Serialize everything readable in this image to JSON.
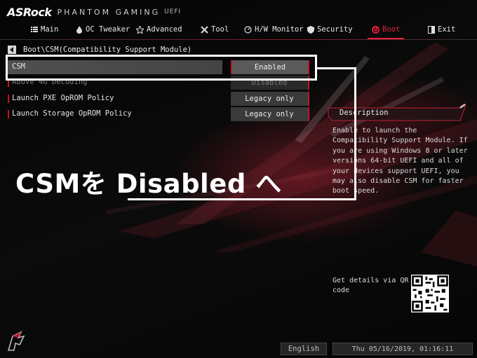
{
  "header": {
    "brand": "ASRock",
    "product": "PHANTOM GAMING",
    "uefi": "UEFI"
  },
  "nav": {
    "items": [
      {
        "label": "Main",
        "icon": "list-icon"
      },
      {
        "label": "OC Tweaker",
        "icon": "flame-icon"
      },
      {
        "label": "Advanced",
        "icon": "star-icon"
      },
      {
        "label": "Tool",
        "icon": "tools-icon"
      },
      {
        "label": "H/W Monitor",
        "icon": "monitor-icon"
      },
      {
        "label": "Security",
        "icon": "shield-icon"
      },
      {
        "label": "Boot",
        "icon": "power-icon"
      },
      {
        "label": "Exit",
        "icon": "exit-icon"
      }
    ],
    "active": "Boot"
  },
  "breadcrumb": "Boot\\CSM(Compatibility Support Module)",
  "options": [
    {
      "label": "CSM",
      "value": "Enabled",
      "selected": true,
      "disabled": false
    },
    {
      "label": "Above 4G Decoding",
      "value": "Disabled",
      "selected": false,
      "disabled": true
    },
    {
      "label": "Launch PXE OpROM Policy",
      "value": "Legacy only",
      "selected": false,
      "disabled": false
    },
    {
      "label": "Launch Storage OpROM Policy",
      "value": "Legacy only",
      "selected": false,
      "disabled": false
    }
  ],
  "description": {
    "title": "Description",
    "text": "Enable to launch the\nCompatibility Support Module. If\nyou are using Windows 8 or later\nversions 64-bit UEFI and all of\nyour devices support UEFI, you\nmay also disable CSM for faster\nboot speed."
  },
  "qr": {
    "text": "Get details via QR\ncode"
  },
  "annotation": {
    "text": "CSMを Disabled へ"
  },
  "footer": {
    "language": "English",
    "datetime": "Thu 05/16/2019, 01:16:11"
  },
  "colors": {
    "accent": "#c01828",
    "active_tab": "#e0203a"
  }
}
